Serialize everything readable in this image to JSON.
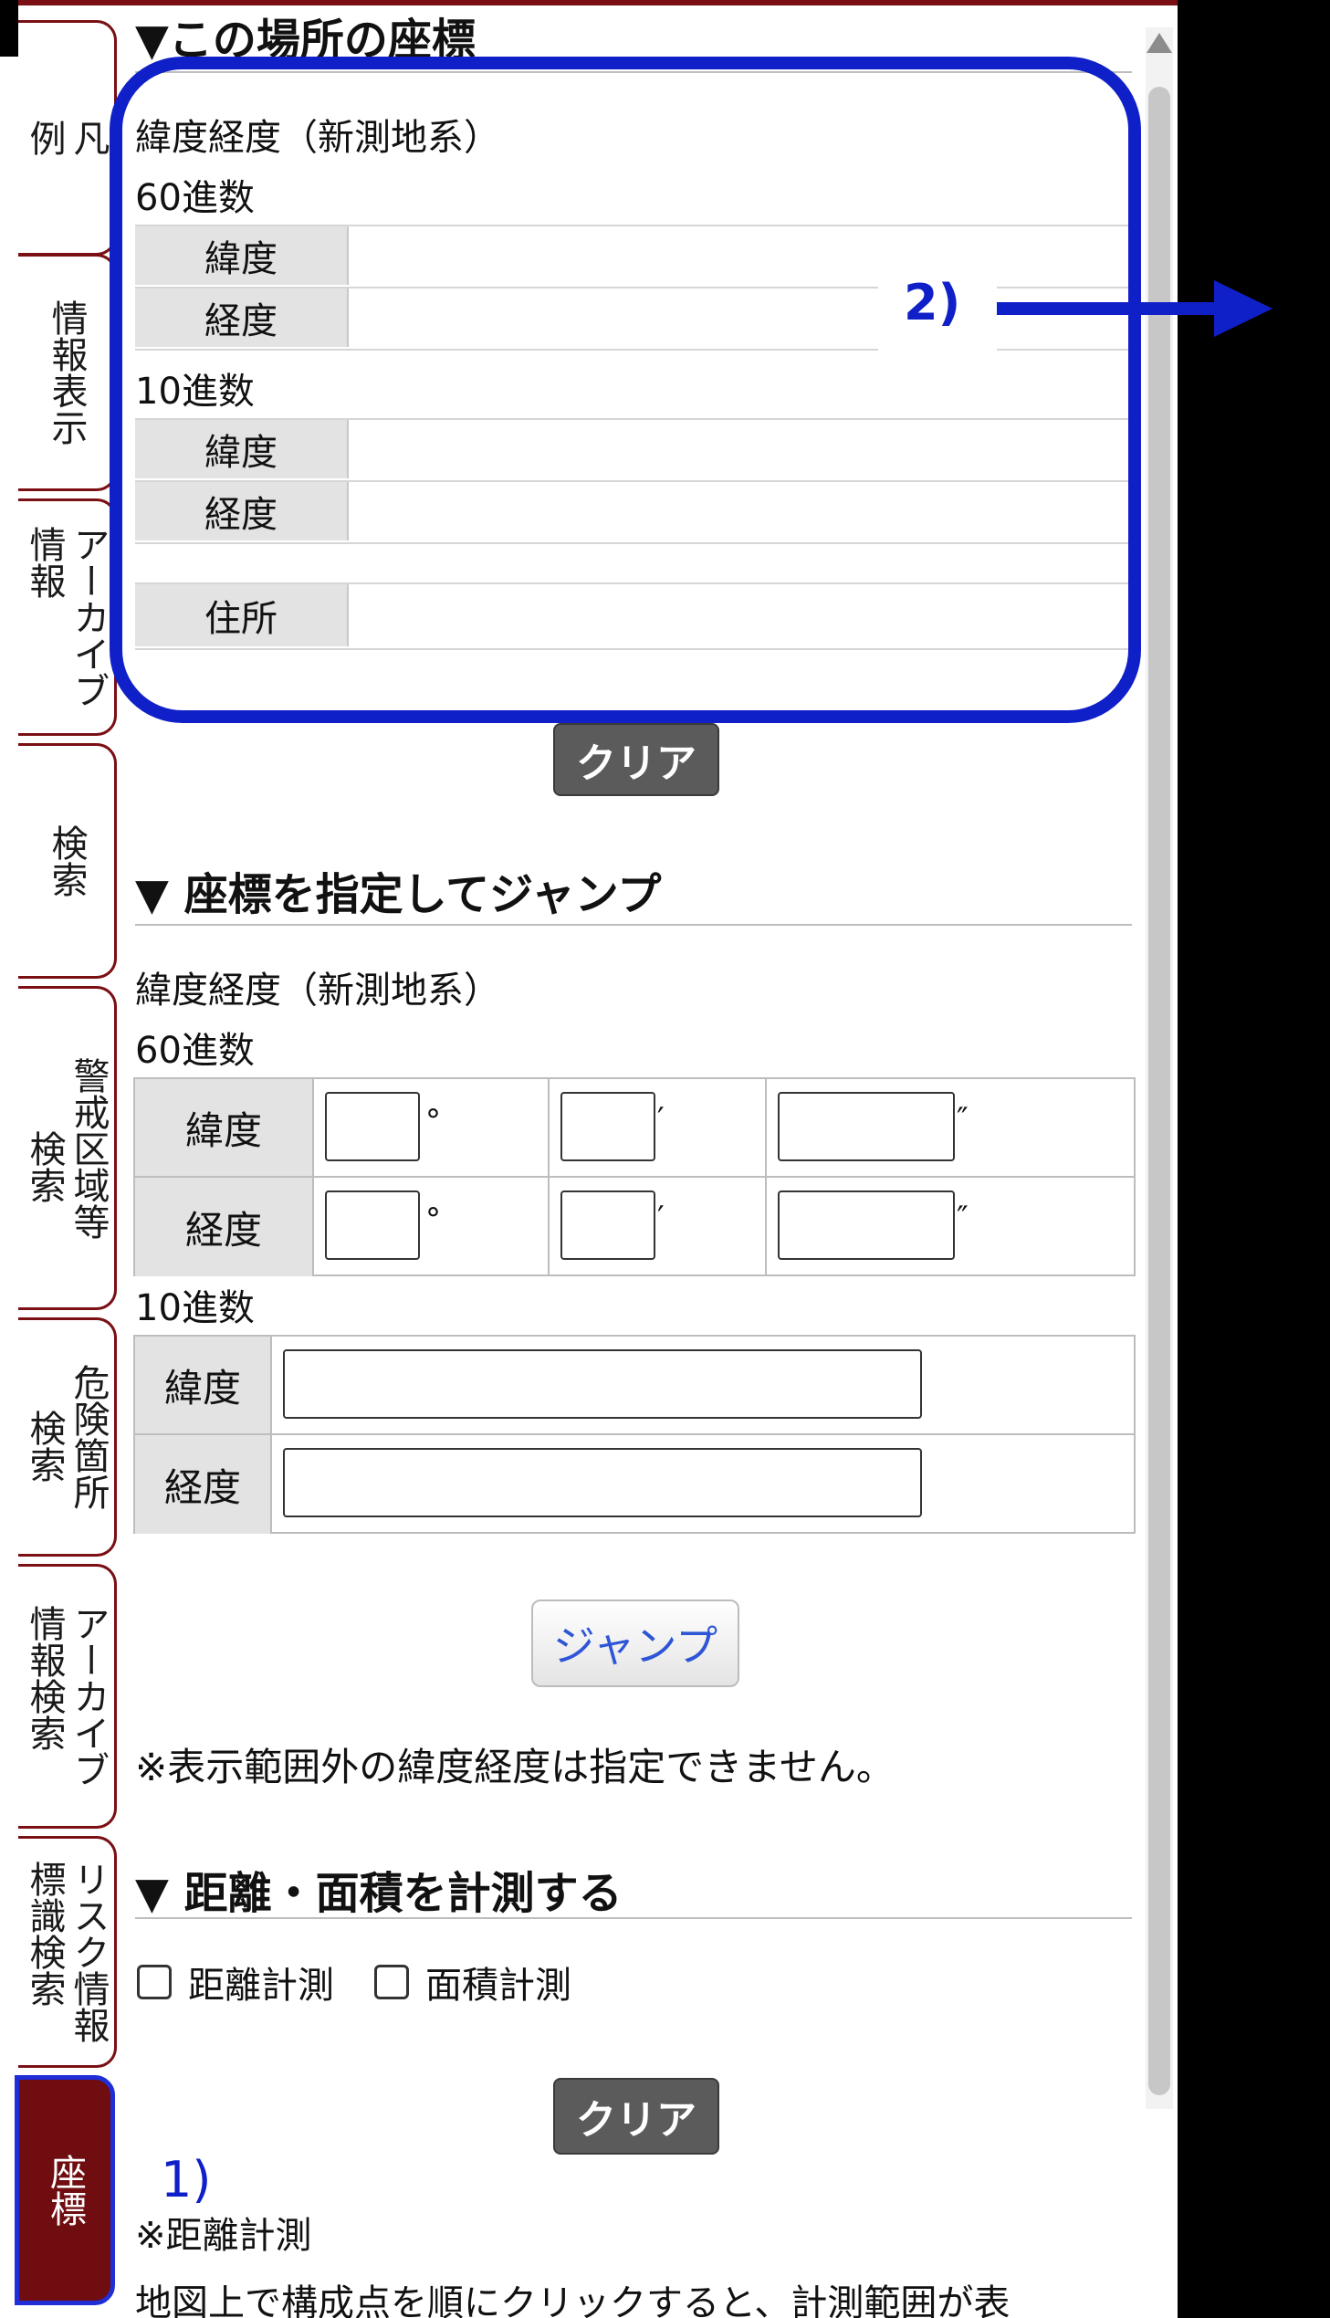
{
  "tabs": [
    {
      "cols": [
        "凡",
        "例"
      ],
      "active": false
    },
    {
      "cols": [
        "情報表示"
      ],
      "active": false
    },
    {
      "cols": [
        "アーカイブ",
        "情報"
      ],
      "active": false
    },
    {
      "cols": [
        "検索"
      ],
      "active": false
    },
    {
      "cols": [
        "警戒区域等",
        "検索"
      ],
      "active": false
    },
    {
      "cols": [
        "危険箇所",
        "検索"
      ],
      "active": false
    },
    {
      "cols": [
        "アーカイブ",
        "情報検索"
      ],
      "active": false
    },
    {
      "cols": [
        "リスク情報",
        "標識検索"
      ],
      "active": false
    },
    {
      "cols": [
        "座標"
      ],
      "active": true
    }
  ],
  "coords_section": {
    "heading": "▼この場所の座標",
    "system_label": "緯度経度（新測地系）",
    "sexagesimal_label": "60進数",
    "decimal_label": "10進数",
    "lat": "緯度",
    "lon": "経度",
    "address": "住所",
    "clear": "クリア"
  },
  "jump_section": {
    "heading": "▼ 座標を指定してジャンプ",
    "system_label": "緯度経度（新測地系）",
    "sexagesimal_label": "60進数",
    "decimal_label": "10進数",
    "lat": "緯度",
    "lon": "経度",
    "deg": "°",
    "min": "′",
    "sec": "″",
    "jump": "ジャンプ",
    "note": "※表示範囲外の緯度経度は指定できません。"
  },
  "measure_section": {
    "heading": "▼ 距離・面積を計測する",
    "distance": "距離計測",
    "area": "面積計測",
    "clear": "クリア",
    "note_title": "※距離計測",
    "note_body": "地図上で構成点を順にクリックすると、計測範囲が表"
  },
  "annotations": {
    "label1": "1)",
    "label2": "2)",
    "color": "#1020c8"
  }
}
